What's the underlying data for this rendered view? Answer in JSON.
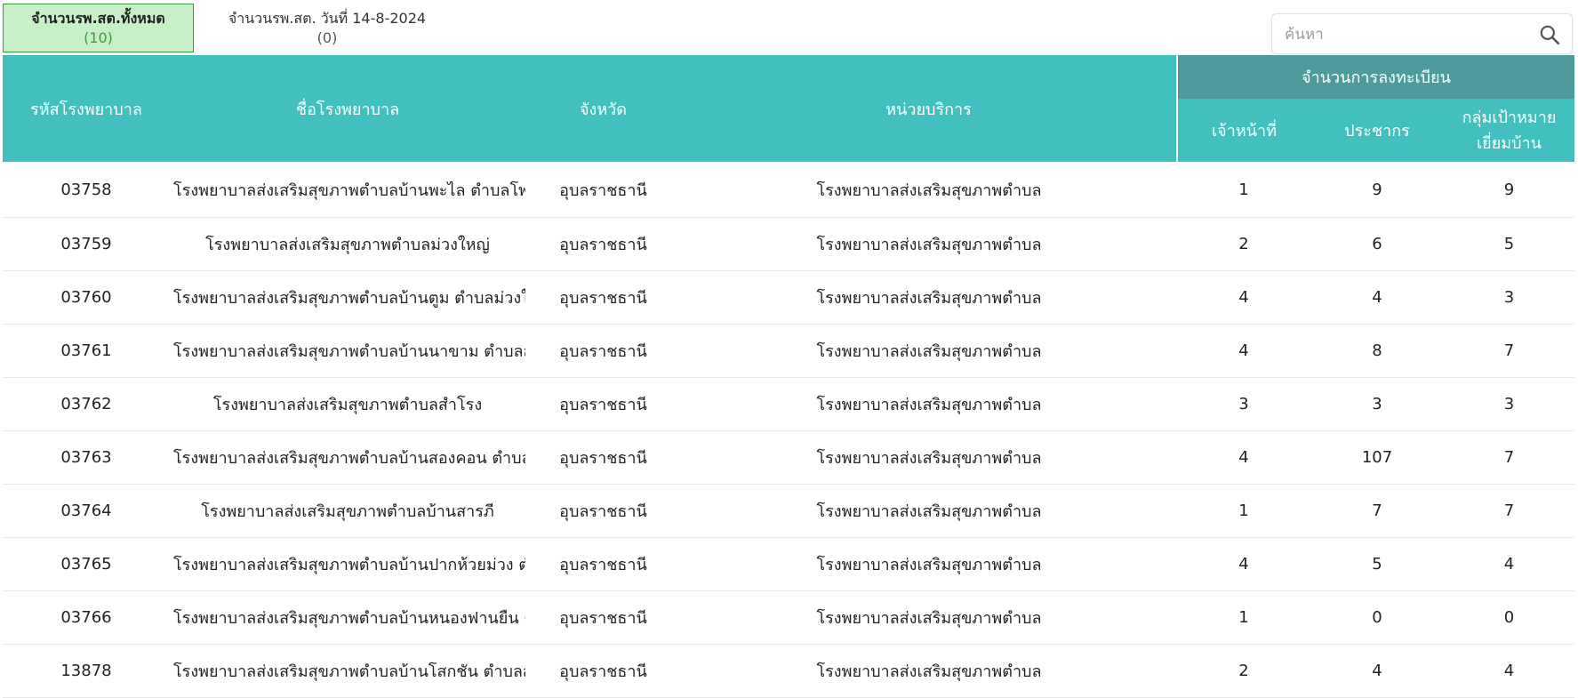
{
  "tabs": [
    {
      "label": "จำนวนรพ.สต.ทั้งหมด",
      "count": "(10)"
    },
    {
      "label": "จำนวนรพ.สต. วันที่ 14-8-2024",
      "count": "(0)"
    }
  ],
  "search": {
    "placeholder": "ค้นหา",
    "icon": "search-icon"
  },
  "table": {
    "headers": {
      "code": "รหัสโรงพยาบาล",
      "name": "ชื่อโรงพยาบาล",
      "province": "จังหวัด",
      "unit": "หน่วยบริการ",
      "group": "จำนวนการลงทะเบียน",
      "staff": "เจ้าหน้าที่",
      "population": "ประชากร",
      "target": "กลุ่มเป้าหมาย\nเยี่ยมบ้าน"
    },
    "rows": [
      {
        "code": "03758",
        "name": "โรงพยาบาลส่งเสริมสุขภาพตำบลบ้านพะไล ตำบลโพธิ์ไทร",
        "province": "อุบลราชธานี",
        "unit": "โรงพยาบาลส่งเสริมสุขภาพตำบล",
        "staff": "1",
        "population": "9",
        "target": "9"
      },
      {
        "code": "03759",
        "name": "โรงพยาบาลส่งเสริมสุขภาพตำบลม่วงใหญ่",
        "province": "อุบลราชธานี",
        "unit": "โรงพยาบาลส่งเสริมสุขภาพตำบล",
        "staff": "2",
        "population": "6",
        "target": "5"
      },
      {
        "code": "03760",
        "name": "โรงพยาบาลส่งเสริมสุขภาพตำบลบ้านตูม ตำบลม่วงใหญ่",
        "province": "อุบลราชธานี",
        "unit": "โรงพยาบาลส่งเสริมสุขภาพตำบล",
        "staff": "4",
        "population": "4",
        "target": "3"
      },
      {
        "code": "03761",
        "name": "โรงพยาบาลส่งเสริมสุขภาพตำบลบ้านนาขาม ตำบลสำโรง",
        "province": "อุบลราชธานี",
        "unit": "โรงพยาบาลส่งเสริมสุขภาพตำบล",
        "staff": "4",
        "population": "8",
        "target": "7"
      },
      {
        "code": "03762",
        "name": "โรงพยาบาลส่งเสริมสุขภาพตำบลสำโรง",
        "province": "อุบลราชธานี",
        "unit": "โรงพยาบาลส่งเสริมสุขภาพตำบล",
        "staff": "3",
        "population": "3",
        "target": "3"
      },
      {
        "code": "03763",
        "name": "โรงพยาบาลส่งเสริมสุขภาพตำบลบ้านสองคอน ตำบลสองคอน",
        "province": "อุบลราชธานี",
        "unit": "โรงพยาบาลส่งเสริมสุขภาพตำบล",
        "staff": "4",
        "population": "107",
        "target": "7"
      },
      {
        "code": "03764",
        "name": "โรงพยาบาลส่งเสริมสุขภาพตำบลบ้านสารภี",
        "province": "อุบลราชธานี",
        "unit": "โรงพยาบาลส่งเสริมสุขภาพตำบล",
        "staff": "1",
        "population": "7",
        "target": "7"
      },
      {
        "code": "03765",
        "name": "โรงพยาบาลส่งเสริมสุขภาพตำบลบ้านปากห้วยม่วง ตำบลเหล่างาม",
        "province": "อุบลราชธานี",
        "unit": "โรงพยาบาลส่งเสริมสุขภาพตำบล",
        "staff": "4",
        "population": "5",
        "target": "4"
      },
      {
        "code": "03766",
        "name": "โรงพยาบาลส่งเสริมสุขภาพตำบลบ้านหนองฟานยืน ตำบลเหล่างาม",
        "province": "อุบลราชธานี",
        "unit": "โรงพยาบาลส่งเสริมสุขภาพตำบล",
        "staff": "1",
        "population": "0",
        "target": "0"
      },
      {
        "code": "13878",
        "name": "โรงพยาบาลส่งเสริมสุขภาพตำบลบ้านโสกชัน ตำบลสารภี",
        "province": "อุบลราชธานี",
        "unit": "โรงพยาบาลส่งเสริมสุขภาพตำบล",
        "staff": "2",
        "population": "4",
        "target": "4"
      }
    ]
  }
}
